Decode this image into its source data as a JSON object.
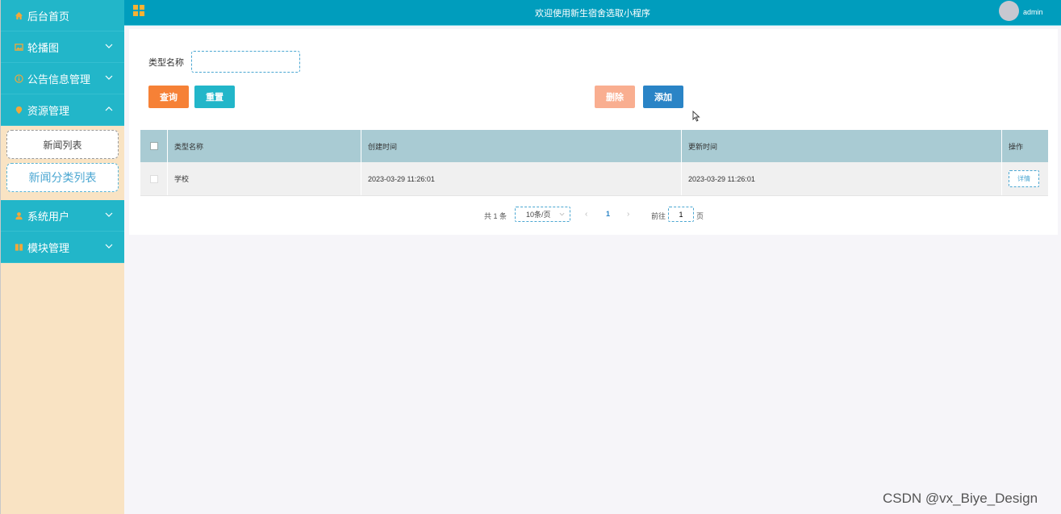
{
  "sidebar": {
    "items": [
      {
        "label": "后台首页",
        "icon": "home-icon"
      },
      {
        "label": "轮播图",
        "icon": "image-icon"
      },
      {
        "label": "公告信息管理",
        "icon": "info-icon"
      },
      {
        "label": "资源管理",
        "icon": "pin-icon"
      },
      {
        "label": "系统用户",
        "icon": "user-icon"
      },
      {
        "label": "模块管理",
        "icon": "module-icon"
      }
    ],
    "submenu": [
      {
        "label": "新闻列表"
      },
      {
        "label": "新闻分类列表",
        "active": true
      }
    ]
  },
  "topbar": {
    "title": "欢迎使用新生宿舍选取小程序",
    "username": "admin"
  },
  "search": {
    "label": "类型名称",
    "value": "",
    "placeholder": ""
  },
  "buttons": {
    "search": "查询",
    "reset": "重置",
    "delete": "删除",
    "add": "添加"
  },
  "table": {
    "headers": [
      "类型名称",
      "创建时间",
      "更新时间",
      "操作"
    ],
    "rows": [
      {
        "name": "学校",
        "created": "2023-03-29 11:26:01",
        "updated": "2023-03-29 11:26:01",
        "action": "详情"
      }
    ]
  },
  "pagination": {
    "total": "共 1 条",
    "page_size": "10条/页",
    "current_page": "1",
    "goto_label": "前往",
    "goto_value": "1",
    "goto_unit": "页"
  },
  "watermark": "CSDN @vx_Biye_Design",
  "colors": {
    "sidebar_nav": "#22b6c9",
    "topbar": "#009dbd",
    "search_button": "#f68136",
    "reset_button": "#22b6c9",
    "delete_button": "#f9ae90",
    "add_button": "#2a84c6"
  }
}
